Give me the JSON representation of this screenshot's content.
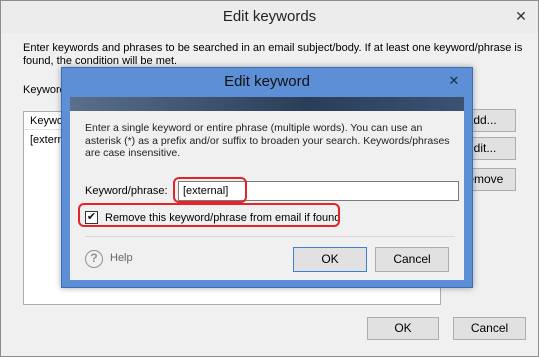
{
  "outer_window": {
    "title": "Edit keywords",
    "close_glyph": "✕",
    "description": "Enter keywords and phrases to be searched in an email subject/body. If at least one keyword/phrase is found, the condition will be met.",
    "keywords_label": "Keywords:",
    "list": {
      "header": "Keyword",
      "rows": [
        "[external]"
      ]
    },
    "buttons": {
      "add": "Add...",
      "edit": "Edit...",
      "remove": "Remove",
      "ok": "OK",
      "cancel": "Cancel"
    }
  },
  "dialog": {
    "title": "Edit keyword",
    "close_glyph": "✕",
    "description": "Enter a single keyword or entire phrase (multiple words). You can use an asterisk (*) as a prefix and/or suffix to broaden your search. Keywords/phrases are case insensitive.",
    "keyword_label": "Keyword/phrase:",
    "keyword_value": "[external]",
    "checkbox_label": "Remove this keyword/phrase from email if found",
    "checkbox_checked": true,
    "check_glyph": "✔",
    "help_glyph": "?",
    "help_label": "Help",
    "ok_label": "OK",
    "cancel_label": "Cancel"
  },
  "colors": {
    "highlight": "#e0252b",
    "dialog_frame": "#5c8fd6",
    "button_focus": "#3c7fd8"
  },
  "icons": {
    "help": "help-circle-icon",
    "close": "close-icon",
    "check": "checkmark-icon"
  }
}
